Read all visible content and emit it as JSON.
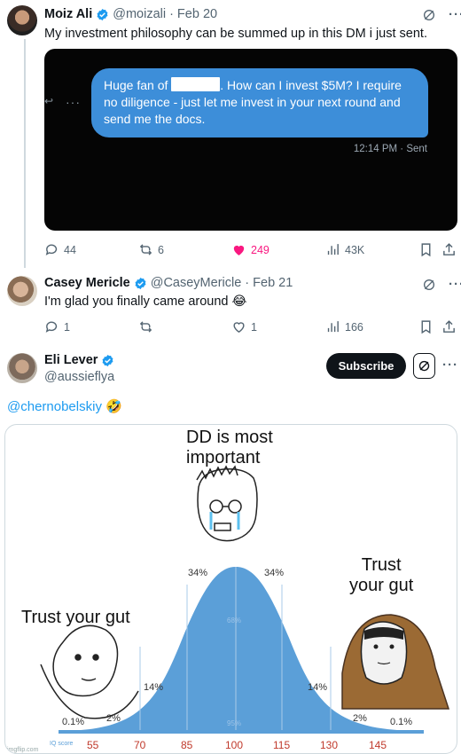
{
  "tweets": [
    {
      "name": "Moiz Ali",
      "handle": "@moizali",
      "date": "· Feb 20",
      "text": "My investment philosophy can be summed up in this DM i just sent.",
      "dm": {
        "message_before": "Huge fan of ",
        "message_after": ". How can I invest $5M? I require no diligence - just let me invest in your next round and send me the docs.",
        "timestamp": "12:14 PM · Sent"
      },
      "stats": {
        "replies": "44",
        "reposts": "6",
        "likes": "249",
        "views": "43K"
      }
    },
    {
      "name": "Casey Mericle",
      "handle": "@CaseyMericle",
      "date": "· Feb 21",
      "text": "I'm glad you finally came around 😂",
      "stats": {
        "replies": "1",
        "reposts": "",
        "likes": "1",
        "views": "166"
      }
    },
    {
      "name": "Eli Lever",
      "handle": "@aussieflya",
      "subscribe_label": "Subscribe",
      "mention": "@chernobelskiy",
      "mention_emoji": "🤣"
    }
  ],
  "meme": {
    "top_text": "DD is most\nimportant",
    "left_text": "Trust your gut",
    "right_text": "Trust\nyour gut",
    "percentages": [
      "0.1%",
      "2%",
      "14%",
      "34%",
      "34%",
      "14%",
      "2%",
      "0.1%"
    ],
    "iq_label": "IQ score",
    "iq_ticks": [
      "55",
      "70",
      "85",
      "100",
      "115",
      "130",
      "145"
    ],
    "watermark": "imgflip.com",
    "inner_labels": [
      "68%",
      "95%"
    ]
  },
  "colors": {
    "accent": "#1d9bf0",
    "like": "#f91880",
    "curve": "#5b9fd8",
    "dm_bubble": "#3d8ed9"
  }
}
